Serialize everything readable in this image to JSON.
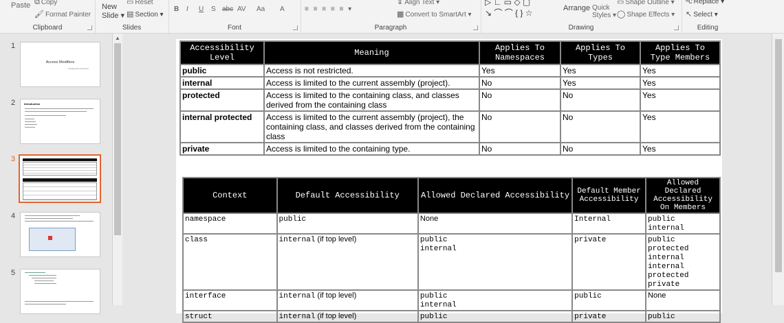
{
  "ribbon": {
    "clipboard": {
      "paste": "Paste",
      "copy": "Copy",
      "format_painter": "Format Painter",
      "group": "Clipboard"
    },
    "slides": {
      "new_slide": "New",
      "new_slide2": "Slide",
      "reset": "Reset",
      "section": "Section",
      "group": "Slides"
    },
    "font": {
      "group": "Font",
      "bold": "B",
      "italic": "I",
      "underline": "U",
      "strike": "S",
      "abc": "abc",
      "spacing": "AV",
      "case": "Aa",
      "color": "A"
    },
    "paragraph": {
      "group": "Paragraph",
      "align_text": "Align Text",
      "convert": "Convert to SmartArt"
    },
    "drawing": {
      "group": "Drawing",
      "arrange": "Arrange",
      "quick": "Quick",
      "styles": "Styles",
      "outline": "Shape Outline",
      "effects": "Shape Effects"
    },
    "editing": {
      "group": "Editing",
      "replace": "Replace",
      "select": "Select"
    }
  },
  "thumbnails": [
    {
      "num": "1",
      "title": "Access Modifiers",
      "sub": "Prepared by  Instructor"
    },
    {
      "num": "2",
      "title": "Introduction"
    },
    {
      "num": "3"
    },
    {
      "num": "4"
    },
    {
      "num": "5"
    }
  ],
  "table1": {
    "headers": [
      "Accessibility Level",
      "Meaning",
      "Applies To Namespaces",
      "Applies To Types",
      "Applies To Type Members"
    ],
    "rows": [
      [
        "public",
        "Access is not restricted.",
        "Yes",
        "Yes",
        "Yes"
      ],
      [
        "internal",
        "Access is limited to the current assembly (project).",
        "No",
        "Yes",
        "Yes"
      ],
      [
        "protected",
        "Access is limited to the containing class, and classes derived from the containing class",
        "No",
        "No",
        "Yes"
      ],
      [
        "internal protected",
        "Access is limited to the current assembly (project), the containing class, and classes derived from the containing class",
        "No",
        "No",
        "Yes"
      ],
      [
        "private",
        "Access is limited to the containing type.",
        "No",
        "No",
        "Yes"
      ]
    ]
  },
  "table2": {
    "headers": [
      "Context",
      "Default Accessibility",
      "Allowed Declared Accessibility",
      "Default Member Accessibility",
      "Allowed Declared Accessibility On Members"
    ],
    "rows": [
      {
        "context": "namespace",
        "default": "public",
        "default_suffix": "",
        "allowed": "None",
        "allowed_mono": false,
        "member": "Internal",
        "members": "public\ninternal",
        "members_mono": true
      },
      {
        "context": "class",
        "default": "internal",
        "default_suffix": " (if top level)",
        "allowed": "public\ninternal",
        "allowed_mono": true,
        "member": "private",
        "members": "public\nprotected\ninternal\ninternal\nprotected\nprivate",
        "members_mono": true
      },
      {
        "context": "interface",
        "default": "internal",
        "default_suffix": " (if top level)",
        "allowed": "public\ninternal",
        "allowed_mono": true,
        "member": "public",
        "members": "None",
        "members_mono": false
      },
      {
        "context": "struct",
        "default": "internal",
        "default_suffix": " (if top level)",
        "allowed": "public",
        "allowed_mono": true,
        "member": "private",
        "members": "public",
        "members_mono": true
      }
    ]
  }
}
